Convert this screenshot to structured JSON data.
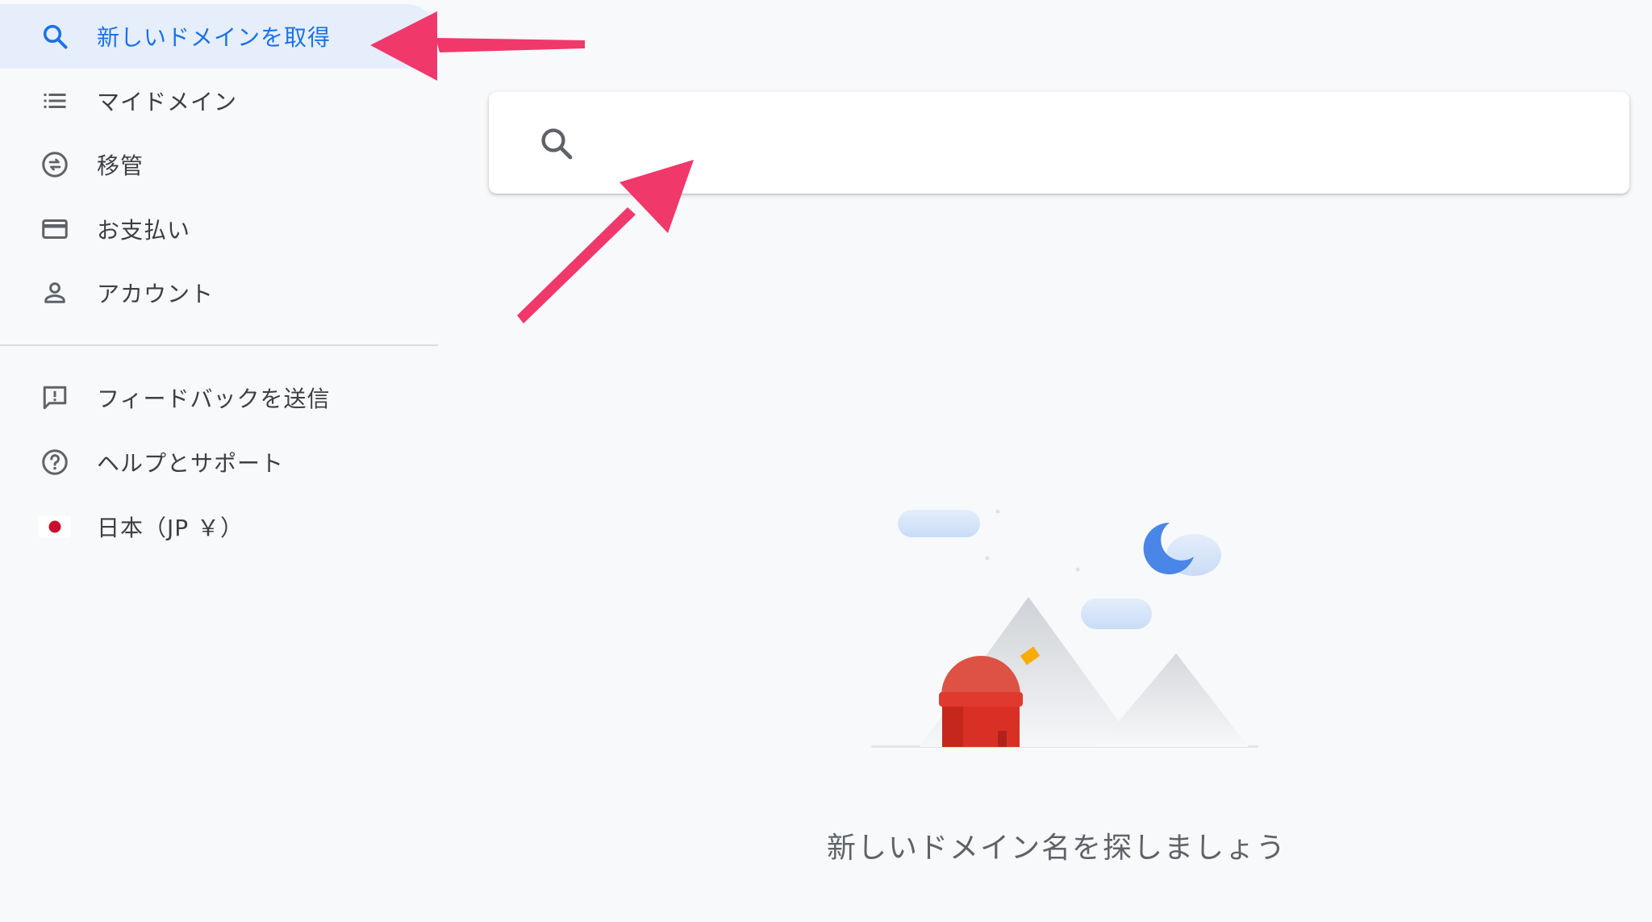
{
  "sidebar": {
    "items": [
      {
        "label": "新しいドメインを取得",
        "icon": "search-icon",
        "active": true
      },
      {
        "label": "マイドメイン",
        "icon": "list-icon",
        "active": false
      },
      {
        "label": "移管",
        "icon": "transfer-icon",
        "active": false
      },
      {
        "label": "お支払い",
        "icon": "credit-card-icon",
        "active": false
      },
      {
        "label": "アカウント",
        "icon": "person-icon",
        "active": false
      }
    ],
    "secondary": [
      {
        "label": "フィードバックを送信",
        "icon": "feedback-icon"
      },
      {
        "label": "ヘルプとサポート",
        "icon": "help-icon"
      },
      {
        "label": "日本（JP ￥）",
        "icon": "japan-flag-icon"
      }
    ]
  },
  "search": {
    "placeholder": "",
    "value": ""
  },
  "empty_state": {
    "message": "新しいドメイン名を探しましょう"
  },
  "colors": {
    "accent": "#1a73e8",
    "active_bg": "#e6eefc",
    "annotation_arrow": "#f0386b",
    "background": "#f8f9fb"
  }
}
